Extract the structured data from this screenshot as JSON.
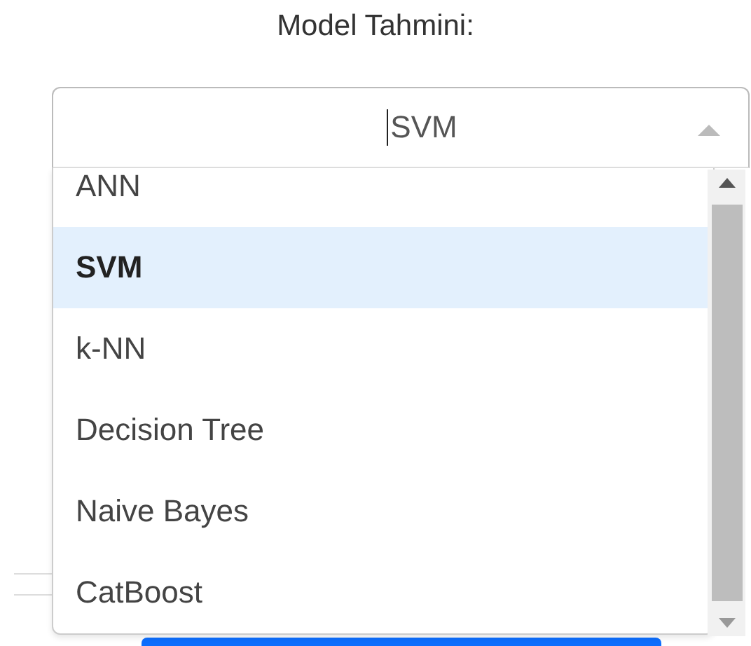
{
  "title": "Model Tahmini:",
  "select": {
    "value": "SVM",
    "expanded": true
  },
  "options": [
    {
      "label": "ANN",
      "selected": false
    },
    {
      "label": "SVM",
      "selected": true
    },
    {
      "label": "k-NN",
      "selected": false
    },
    {
      "label": "Decision Tree",
      "selected": false
    },
    {
      "label": "Naive Bayes",
      "selected": false
    },
    {
      "label": "CatBoost",
      "selected": false
    }
  ]
}
